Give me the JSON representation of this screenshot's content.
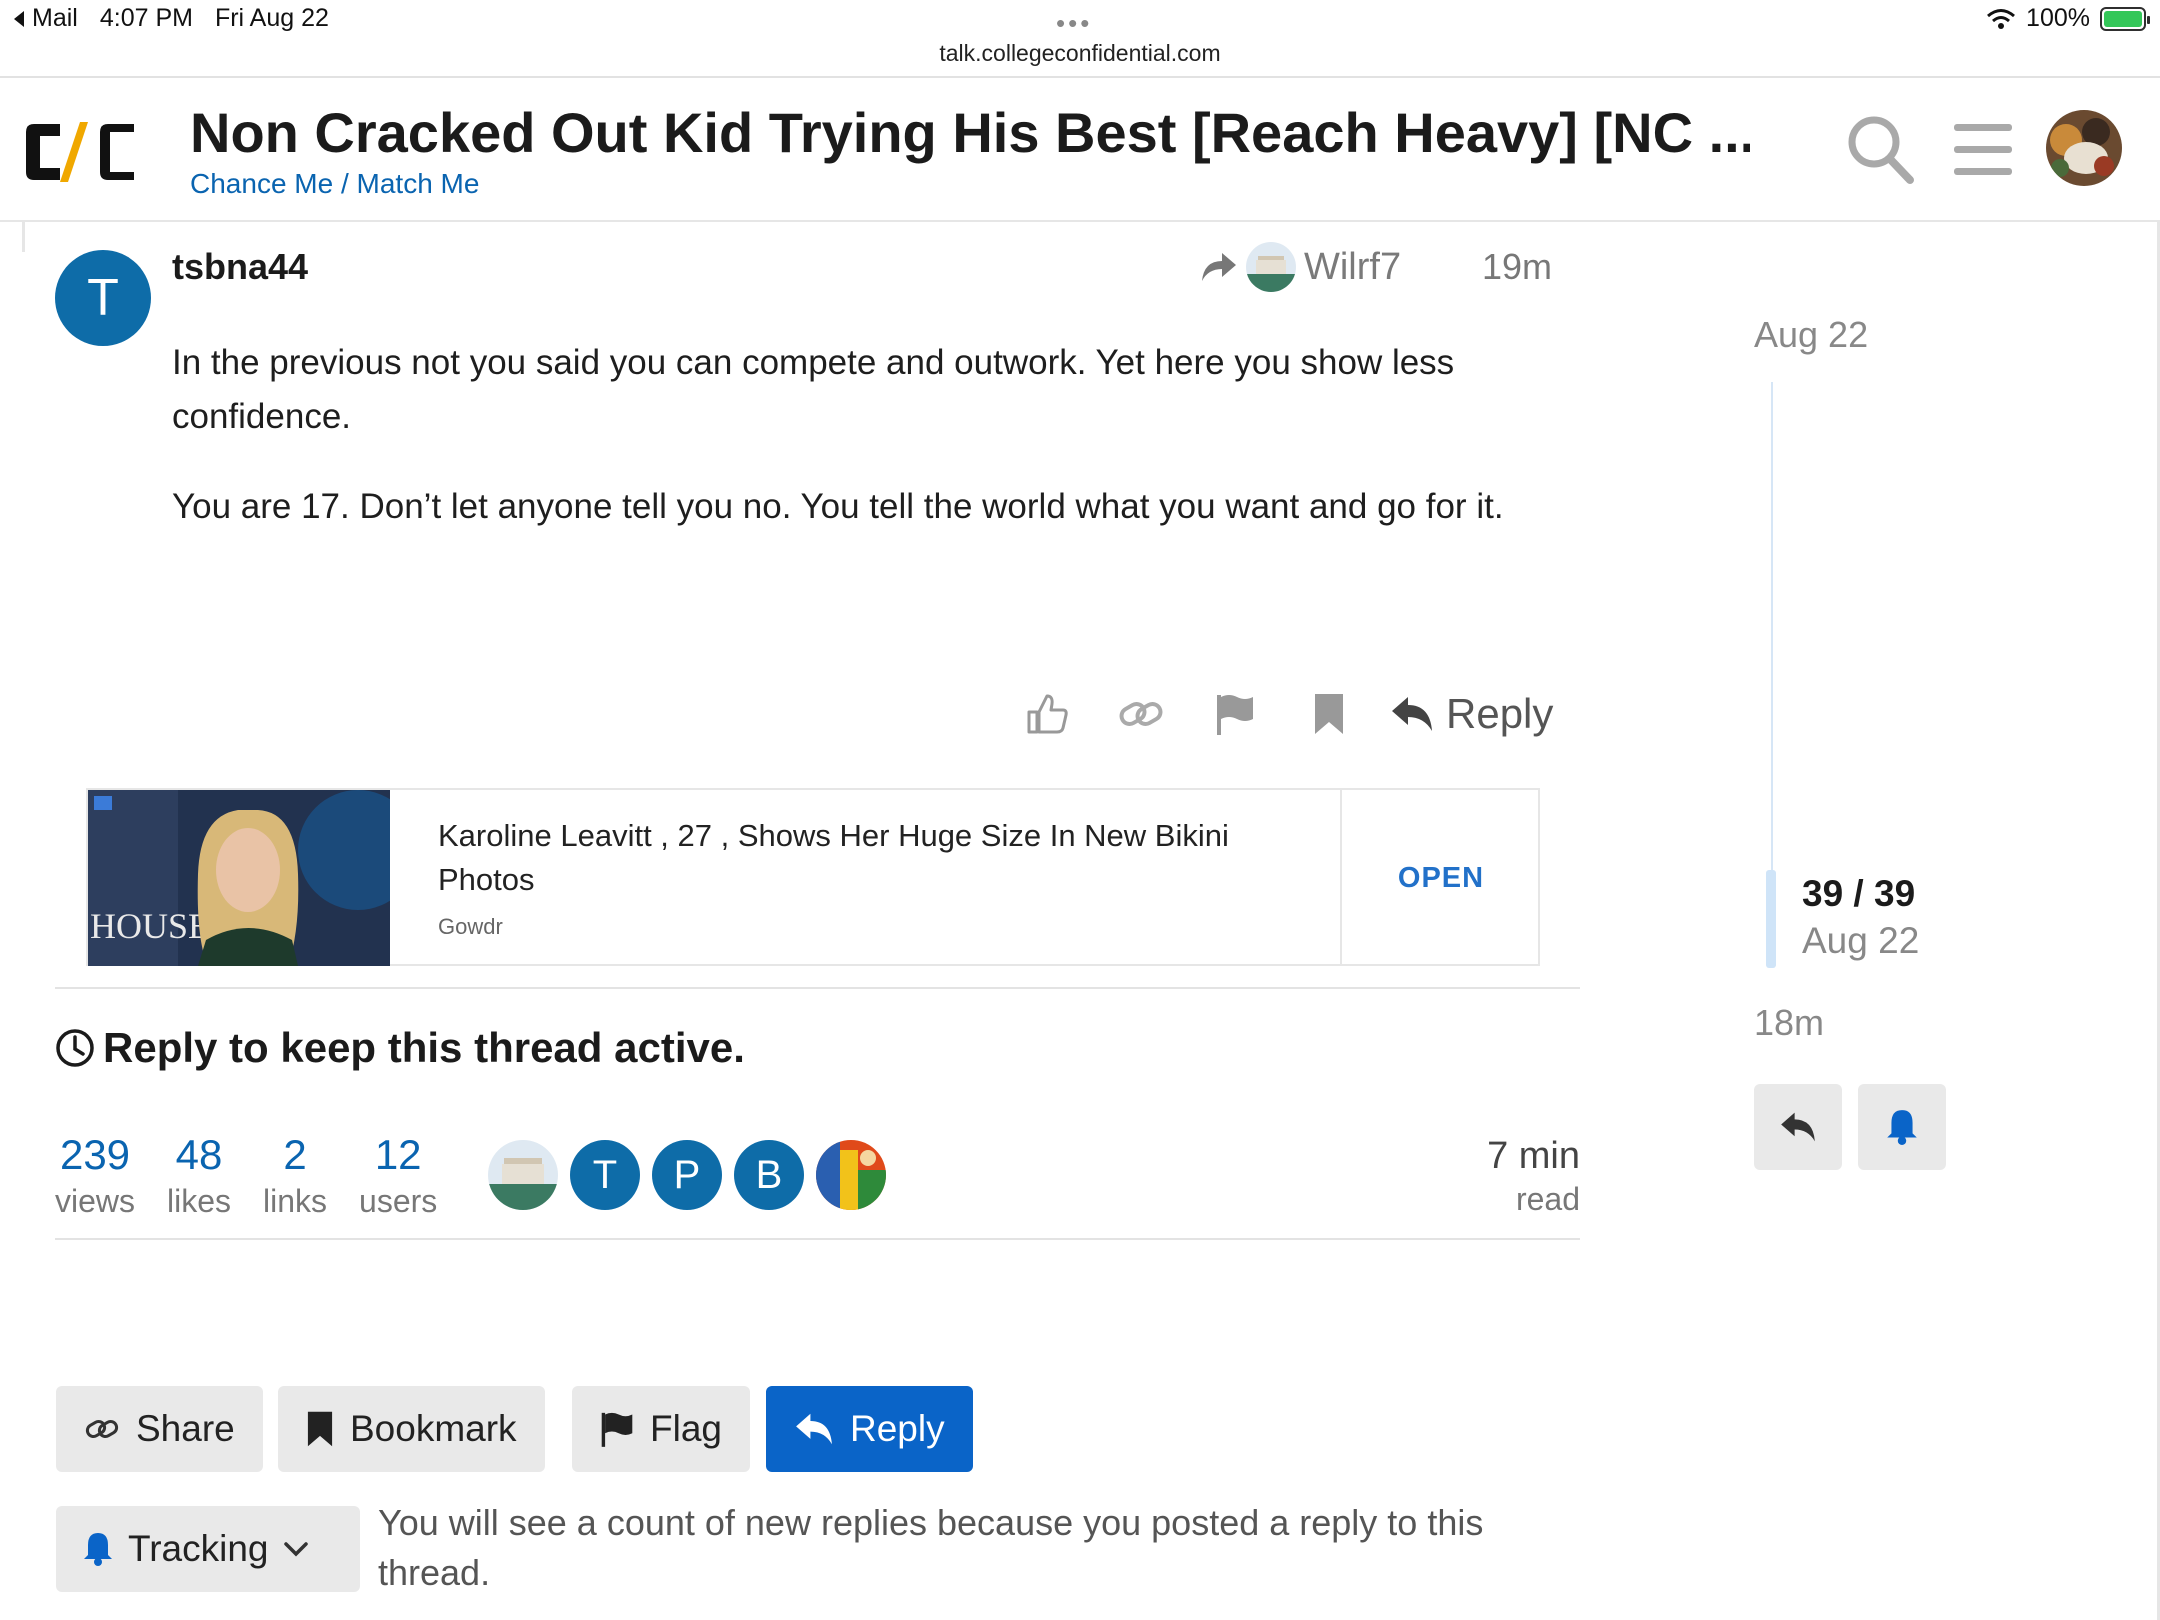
{
  "status_bar": {
    "back_app": "Mail",
    "time": "4:07 PM",
    "date": "Fri Aug 22",
    "url": "talk.collegeconfidential.com",
    "battery": "100%"
  },
  "header": {
    "title": "Non Cracked Out Kid Trying His Best [Reach Heavy] [NC ...",
    "category": "Chance Me / Match Me"
  },
  "post": {
    "avatar_letter": "T",
    "username": "tsbna44",
    "reply_to_user": "Wilrf7",
    "time": "19m",
    "paragraphs": [
      "In the previous not you said you can compete and outwork. Yet here you show less confidence.",
      "You are 17. Don’t let anyone tell you no. You tell the world what you want and go for it."
    ],
    "reply_label": "Reply"
  },
  "ad": {
    "headline": "Karoline Leavitt , 27 , Shows Her Huge Size In New Bikini Photos",
    "source": "Gowdr",
    "cta": "OPEN"
  },
  "notice": "Reply to keep this thread active.",
  "stats": [
    {
      "num": "239",
      "label": "views"
    },
    {
      "num": "48",
      "label": "likes"
    },
    {
      "num": "2",
      "label": "links"
    },
    {
      "num": "12",
      "label": "users"
    }
  ],
  "participants": [
    "T",
    "P",
    "B"
  ],
  "read_time": {
    "num": "7 min",
    "label": "read"
  },
  "footer": {
    "share": "Share",
    "bookmark": "Bookmark",
    "flag": "Flag",
    "reply": "Reply",
    "tracking": "Tracking",
    "tracking_text": "You will see a count of new replies because you posted a reply to this thread."
  },
  "timeline": {
    "start_date": "Aug 22",
    "position": "39 / 39",
    "position_date": "Aug 22",
    "end_label": "18m"
  },
  "colors": {
    "link_blue": "#0a64b0",
    "primary_button": "#0a64c8",
    "avatar_blue": "#0e6ca8",
    "battery_green": "#34c759"
  },
  "icons": [
    "back-arrow-icon",
    "wifi-icon",
    "battery-icon",
    "search-icon",
    "hamburger-menu-icon",
    "share-reply-icon",
    "like-icon",
    "link-icon",
    "flag-icon",
    "bookmark-icon",
    "reply-icon",
    "clock-icon",
    "bell-icon",
    "chevron-down-icon"
  ]
}
